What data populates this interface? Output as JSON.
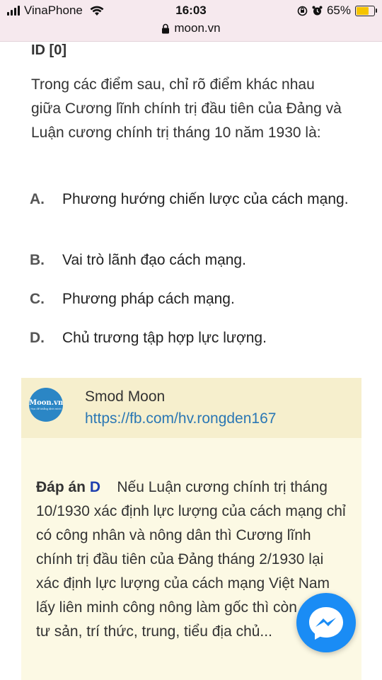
{
  "status_bar": {
    "carrier": "VinaPhone",
    "time": "16:03",
    "battery": "65%",
    "battery_level": 0.65,
    "url": "moon.vn"
  },
  "question": {
    "id_label": "ID [0]",
    "text": "Trong các điểm sau, chỉ rõ điểm khác nhau giữa Cương lĩnh chính trị đầu tiên của Đảng và Luận cương chính trị tháng 10 năm 1930 là:",
    "options": [
      {
        "letter": "A.",
        "text": "Phương hướng chiến lược của cách mạng."
      },
      {
        "letter": "B.",
        "text": "Vai trò lãnh đạo cách mạng."
      },
      {
        "letter": "C.",
        "text": "Phương pháp cách mạng."
      },
      {
        "letter": "D.",
        "text": "Chủ trương tập hợp lực lượng."
      }
    ]
  },
  "comment": {
    "avatar_text": "Moon.vn",
    "avatar_tagline": "Học để khẳng định mình",
    "author": "Smod Moon",
    "link": "https://fb.com/hv.rongden167",
    "answer_label": "Đáp án",
    "answer_key": "D",
    "answer_text": "Nếu Luận cương chính trị tháng 10/1930 xác định lực lượng của cách mạng chỉ có công nhân và nông dân thì Cương lĩnh chính trị đầu tiên của Đảng tháng 2/1930 lại xác định lực lượng của cách mạng Việt Nam lấy liên minh công nông làm gốc thì còn có tiêu tư sản, trí thức, trung, tiểu địa chủ..."
  },
  "colors": {
    "card_bg": "#fcf9e4",
    "card_head_bg": "#f6efcd",
    "link": "#2a77b4",
    "answer_key": "#1e3fae",
    "messenger": "#1a8cf5"
  }
}
